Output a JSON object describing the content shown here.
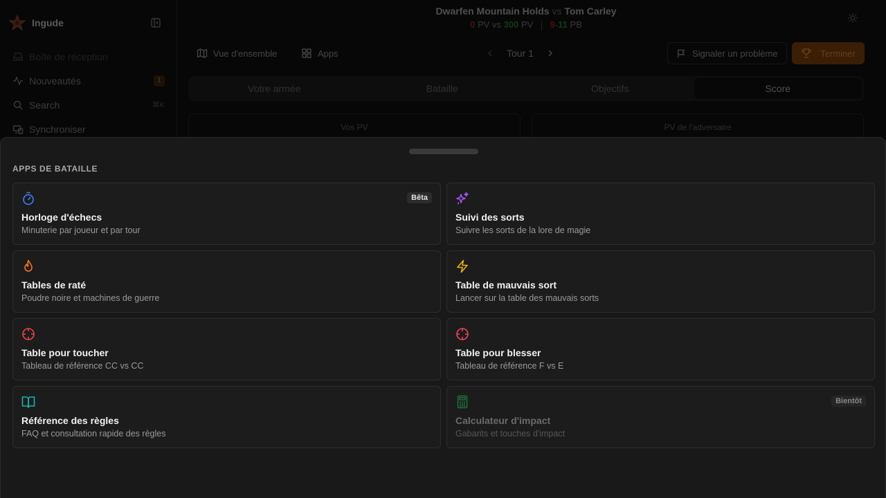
{
  "sidebar": {
    "brand": "Ingude",
    "items": [
      {
        "label": "Boîte de réception",
        "icon": "inbox-icon"
      },
      {
        "label": "Nouveautés",
        "icon": "activity-icon",
        "badge": "1"
      },
      {
        "label": "Search",
        "icon": "search-icon",
        "shortcut": "⌘K"
      },
      {
        "label": "Synchroniser",
        "icon": "sync-devices-icon"
      }
    ]
  },
  "header": {
    "army": "Dwarfen Mountain Holds",
    "vs": "vs",
    "opponent": "Tom Carley",
    "my_pv": "0",
    "pv_label": "PV",
    "opp_pv": "300",
    "pb_left": "9",
    "pb_dash": "-",
    "pb_right": "11",
    "pb_label": "PB"
  },
  "toolbar": {
    "overview": "Vue d'ensemble",
    "apps": "Apps",
    "turn": "Tour 1",
    "report": "Signaler un problème",
    "finish": "Terminer"
  },
  "tabs": [
    "Votre armée",
    "Bataille",
    "Objectifs",
    "Score"
  ],
  "active_tab": "Score",
  "pv_cards": {
    "mine": "Vos PV",
    "opponent": "PV de l'adversaire"
  },
  "sheet": {
    "title": "APPS DE BATAILLE",
    "apps": [
      {
        "title": "Horloge d'échecs",
        "desc": "Minuterie par joueur et par tour",
        "icon": "timer-icon",
        "color": "#3b82f6",
        "tag": "Bêta",
        "enabled": true
      },
      {
        "title": "Suivi des sorts",
        "desc": "Suivre les sorts de la lore de magie",
        "icon": "sparkles-icon",
        "color": "#a855f7",
        "enabled": true
      },
      {
        "title": "Tables de raté",
        "desc": "Poudre noire et machines de guerre",
        "icon": "flame-icon",
        "color": "#f97316",
        "enabled": true
      },
      {
        "title": "Table de mauvais sort",
        "desc": "Lancer sur la table des mauvais sorts",
        "icon": "zap-icon",
        "color": "#eab308",
        "enabled": true
      },
      {
        "title": "Table pour toucher",
        "desc": "Tableau de référence CC vs CC",
        "icon": "crosshair-icon",
        "color": "#ef4444",
        "enabled": true
      },
      {
        "title": "Table pour blesser",
        "desc": "Tableau de référence F vs E",
        "icon": "crosshair-icon",
        "color": "#f43f5e",
        "enabled": true
      },
      {
        "title": "Référence des règles",
        "desc": "FAQ et consultation rapide des règles",
        "icon": "book-open-icon",
        "color": "#14b8a6",
        "enabled": true
      },
      {
        "title": "Calculateur d'impact",
        "desc": "Gabarits et touches d'impact",
        "icon": "calculator-icon",
        "color": "#22c55e",
        "tag": "Bientôt",
        "enabled": false
      }
    ]
  }
}
